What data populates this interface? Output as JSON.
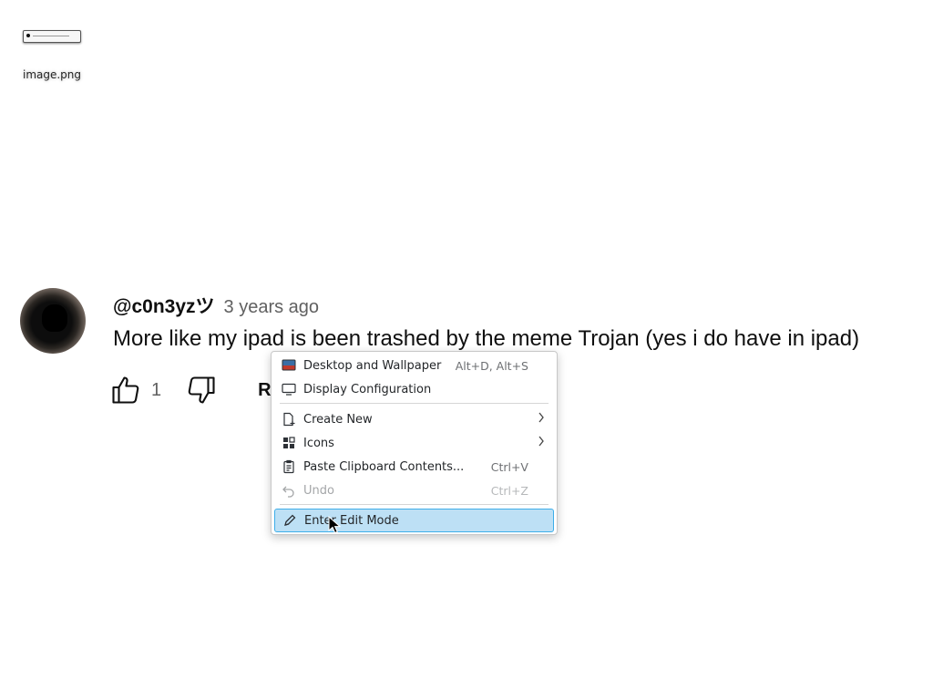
{
  "desktop": {
    "icons": [
      {
        "name": "image.png",
        "icon": "image-file-icon"
      }
    ]
  },
  "comment": {
    "author": "@c0n3yzツ",
    "time": "3 years ago",
    "text": "More like my ipad is been trashed by the meme Trojan (yes i do have in ipad)",
    "likes": "1",
    "reply_label": "R"
  },
  "context_menu": {
    "items": [
      {
        "label": "Desktop and Wallpaper",
        "shortcut": "Alt+D, Alt+S",
        "icon": "wallpaper-icon"
      },
      {
        "label": "Display Configuration",
        "shortcut": "",
        "icon": "monitor-icon"
      },
      {
        "label": "Create New",
        "shortcut": "",
        "icon": "new-document-icon",
        "submenu": true
      },
      {
        "label": "Icons",
        "shortcut": "",
        "icon": "grid-icon",
        "submenu": true
      },
      {
        "label": "Paste Clipboard Contents...",
        "shortcut": "Ctrl+V",
        "icon": "clipboard-icon"
      },
      {
        "label": "Undo",
        "shortcut": "Ctrl+Z",
        "icon": "undo-icon",
        "disabled": true
      },
      {
        "label": "Enter Edit Mode",
        "shortcut": "",
        "icon": "pencil-icon",
        "highlighted": true
      }
    ],
    "highlight_color": "#bde0f5",
    "highlight_border": "#3daee9"
  }
}
